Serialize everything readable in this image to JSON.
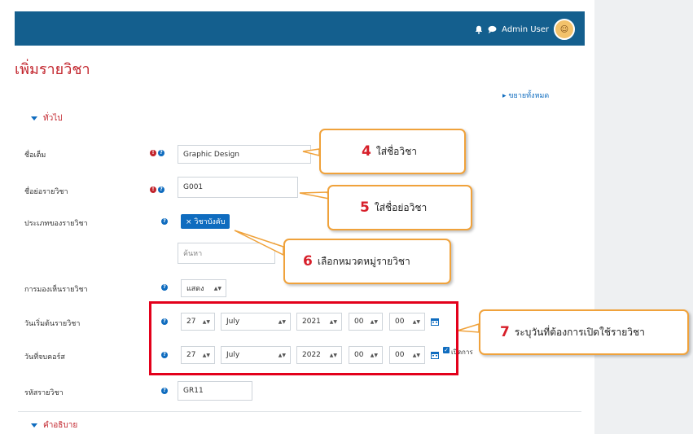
{
  "navbar": {
    "user_name": "Admin User",
    "icons": [
      "bell-icon",
      "chat-icon"
    ]
  },
  "page_title": "เพิ่มรายวิชา",
  "expand_all": "ขยายทั้งหมด",
  "sections": {
    "general": "ทั่วไป",
    "description": "คำอธิบาย"
  },
  "form": {
    "fullname": {
      "label": "ชื่อเต็ม",
      "value": "Graphic Design"
    },
    "shortname": {
      "label": "ชื่อย่อรายวิชา",
      "value": "G001"
    },
    "category": {
      "label": "ประเภทของรายวิชา",
      "chip": "× วิชาบังคับ",
      "search_placeholder": "ค้นหา"
    },
    "visibility": {
      "label": "การมองเห็นรายวิชา",
      "value": "แสดง"
    },
    "start_date": {
      "label": "วันเริ่มต้นรายวิชา",
      "day": "27",
      "month": "July",
      "year": "2021",
      "hour": "00",
      "minute": "00"
    },
    "end_date": {
      "label": "วันที่จบคอร์ส",
      "day": "27",
      "month": "July",
      "year": "2022",
      "hour": "00",
      "minute": "00",
      "enable_label": "เปิดการ"
    },
    "idnumber": {
      "label": "รหัสรายวิชา",
      "value": "GR11"
    }
  },
  "callouts": [
    {
      "num": "4",
      "text": "ใส่ชื่อวิชา"
    },
    {
      "num": "5",
      "text": "ใส่ชื่อย่อวิชา"
    },
    {
      "num": "6",
      "text": "เลือกหมวดหมู่รายวิชา"
    },
    {
      "num": "7",
      "text": "ระบุวันที่ต้องการเปิดใช้รายวิชา"
    }
  ],
  "colors": {
    "navbar": "#145f8e",
    "title": "#c2242c",
    "accent": "#0f6cbf",
    "callout_border": "#f0a23b",
    "highlight": "#e3001b"
  }
}
